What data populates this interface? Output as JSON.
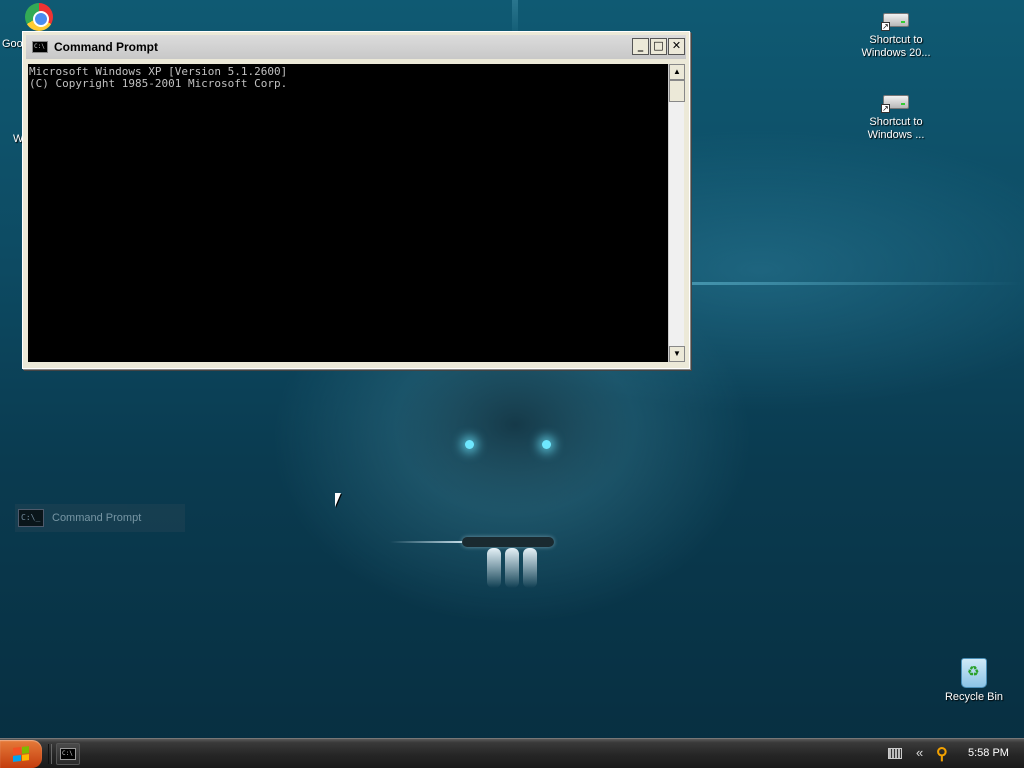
{
  "desktop": {
    "icons": [
      {
        "name": "chrome",
        "label_visible": "Goo"
      },
      {
        "name": "shortcut-windows-1",
        "label": "Shortcut to Windows 20..."
      },
      {
        "name": "shortcut-windows-2",
        "label": "Shortcut to Windows ..."
      },
      {
        "name": "recycle-bin",
        "label": "Recycle Bin"
      }
    ],
    "clipped_left_label": "W"
  },
  "cmd_window": {
    "title": "Command Prompt",
    "icon_text": "C:\\",
    "buttons": {
      "minimize": "_",
      "maximize": "□",
      "close": "✕"
    },
    "console_lines": [
      "Microsoft Windows XP [Version 5.1.2600]",
      "(C) Copyright 1985-2001 Microsoft Corp."
    ]
  },
  "ghost_task": {
    "icon_text": "C:\\_",
    "label": "Command Prompt"
  },
  "taskbar": {
    "start_label": "",
    "cmd_icon_text": "C:\\",
    "tray_chevron": "«",
    "tray_search": "⚲",
    "clock": "5:58 PM"
  },
  "colors": {
    "desktop_bg": "#0d4a62",
    "console_bg": "#000000",
    "console_text": "#c0c0c0",
    "start_button": "#d4561c",
    "taskbar": "#262626"
  }
}
